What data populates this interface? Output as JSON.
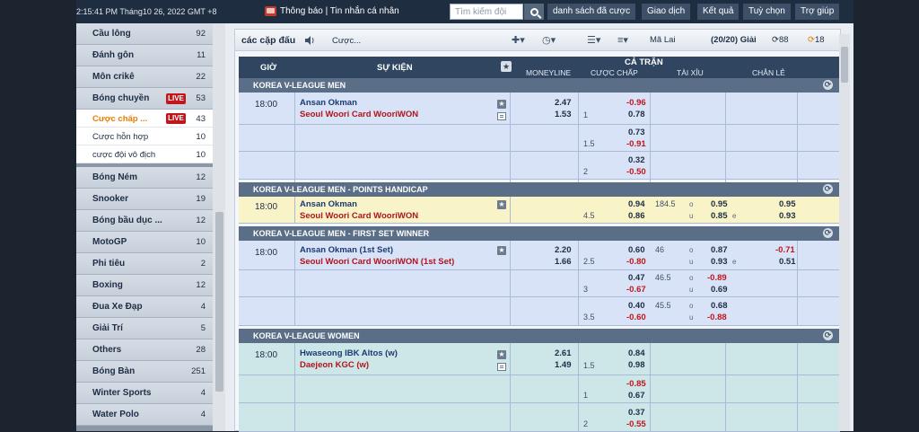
{
  "topbar": {
    "clock": "2:15:41 PM Tháng10 26, 2022 GMT +8",
    "notice": "Thông báo | Tin nhắn cá nhân",
    "search_placeholder": "Tìm kiếm đội",
    "nav": [
      "danh sách đã cược",
      "Giao dịch",
      "Kết quả",
      "Tuỳ chọn",
      "Trợ giúp"
    ]
  },
  "sidebar": {
    "items": [
      {
        "label": "Cầu lông",
        "count": "92"
      },
      {
        "label": "Đánh gôn",
        "count": "11"
      },
      {
        "label": "Môn crikê",
        "count": "22"
      },
      {
        "label": "Bóng chuyền",
        "count": "53",
        "live": "LIVE"
      },
      {
        "label": "Bóng Ném",
        "count": "12"
      },
      {
        "label": "Snooker",
        "count": "19"
      },
      {
        "label": "Bóng bầu dục ...",
        "count": "12"
      },
      {
        "label": "MotoGP",
        "count": "10"
      },
      {
        "label": "Phi tiêu",
        "count": "2"
      },
      {
        "label": "Boxing",
        "count": "12"
      },
      {
        "label": "Đua Xe Đạp",
        "count": "4"
      },
      {
        "label": "Giải Trí",
        "count": "5"
      },
      {
        "label": "Others",
        "count": "28"
      },
      {
        "label": "Bóng Bàn",
        "count": "251"
      },
      {
        "label": "Winter Sports",
        "count": "4"
      },
      {
        "label": "Water Polo",
        "count": "4"
      }
    ],
    "subs": [
      {
        "label": "Cược chấp ...",
        "count": "43",
        "live": "LIVE"
      },
      {
        "label": "Cược hỗn hợp",
        "count": "10"
      },
      {
        "label": "cược đội vô địch",
        "count": "10"
      }
    ]
  },
  "toolbar": {
    "title": "các cặp đấu",
    "bet": "Cược...",
    "odds_type": "Mã Lai",
    "count": "(20/20) Giải",
    "refresh1": "88",
    "refresh2": "18"
  },
  "table": {
    "headers": {
      "time": "GIỜ",
      "event": "SỰ KIỆN",
      "full": "CẢ TRẬN",
      "moneyline": "MONEYLINE",
      "handicap": "CƯỢC CHẤP",
      "overunder": "TÀI XỈU",
      "oddeven": "CHẴN LẺ"
    },
    "leagues": [
      "KOREA V-LEAGUE MEN",
      "KOREA V-LEAGUE MEN - POINTS HANDICAP",
      "KOREA V-LEAGUE MEN - FIRST SET WINNER",
      "KOREA V-LEAGUE WOMEN"
    ],
    "m1": {
      "time": "18:00",
      "teamA": "Ansan Okman",
      "teamB": "Seoul Woori Card WooriWON",
      "mlA": "2.47",
      "mlB": "1.53",
      "r1": {
        "hc": "1",
        "a": "-0.96",
        "b": "0.78"
      },
      "r2": {
        "hc": "1.5",
        "a": "0.73",
        "b": "-0.91"
      },
      "r3": {
        "hc": "2",
        "a": "0.32",
        "b": "-0.50"
      }
    },
    "m2": {
      "time": "18:00",
      "teamA": "Ansan Okman",
      "teamB": "Seoul Woori Card WooriWON",
      "hc": "4.5",
      "a": "0.94",
      "b": "0.86",
      "ou": "184.5",
      "o": "o",
      "u": "u",
      "ouA": "0.95",
      "ouB": "0.85",
      "e": "e",
      "oeA": "0.95",
      "oeB": "0.93"
    },
    "m3": {
      "time": "18:00",
      "teamA": "Ansan Okman (1st Set)",
      "teamB": "Seoul Woori Card WooriWON (1st Set)",
      "mlA": "2.20",
      "mlB": "1.66",
      "r1": {
        "hc": "2.5",
        "a": "0.60",
        "b": "-0.80",
        "ou": "46",
        "ouA": "0.87",
        "ouB": "0.93",
        "oeA": "-0.71",
        "oeB": "0.51"
      },
      "r2": {
        "hc": "3",
        "a": "0.47",
        "b": "-0.67",
        "ou": "46.5",
        "ouA": "-0.89",
        "ouB": "0.69"
      },
      "r3": {
        "hc": "3.5",
        "a": "0.40",
        "b": "-0.60",
        "ou": "45.5",
        "ouA": "0.68",
        "ouB": "-0.88"
      }
    },
    "m4": {
      "time": "18:00",
      "teamA": "Hwaseong IBK Altos (w)",
      "teamB": "Daejeon KGC (w)",
      "mlA": "2.61",
      "mlB": "1.49",
      "r1": {
        "hc": "1.5",
        "a": "0.84",
        "b": "0.98"
      },
      "r2": {
        "hc": "1",
        "a": "-0.85",
        "b": "0.67"
      },
      "r3": {
        "hc": "2",
        "a": "0.37",
        "b": "-0.55"
      }
    }
  }
}
